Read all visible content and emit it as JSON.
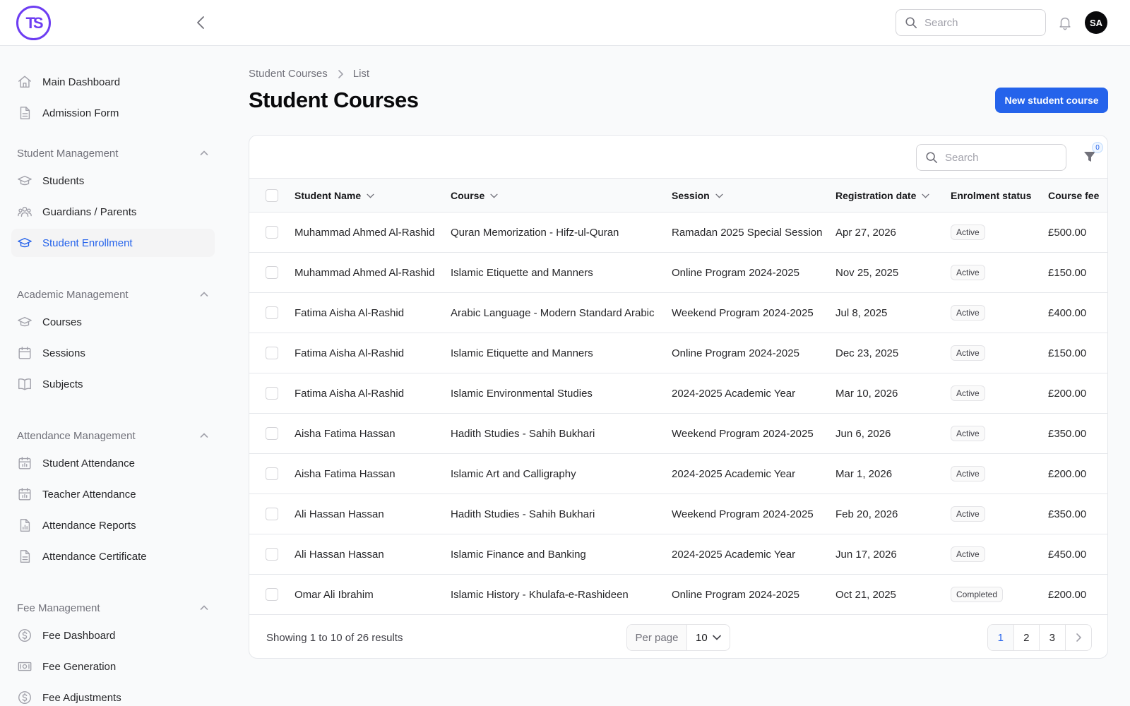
{
  "topbar": {
    "logo_text": "TS",
    "search_placeholder": "Search",
    "avatar_initials": "SA"
  },
  "sidebar": {
    "items_top": [
      {
        "label": "Main Dashboard",
        "icon": "home-icon"
      },
      {
        "label": "Admission Form",
        "icon": "document-icon"
      }
    ],
    "groups": [
      {
        "label": "Student Management",
        "items": [
          {
            "label": "Students",
            "icon": "graduation-cap-icon"
          },
          {
            "label": "Guardians / Parents",
            "icon": "users-icon"
          },
          {
            "label": "Student Enrollment",
            "icon": "graduation-cap-icon",
            "active": true
          }
        ]
      },
      {
        "label": "Academic Management",
        "items": [
          {
            "label": "Courses",
            "icon": "graduation-cap-icon"
          },
          {
            "label": "Sessions",
            "icon": "calendar-icon"
          },
          {
            "label": "Subjects",
            "icon": "book-icon"
          }
        ]
      },
      {
        "label": "Attendance Management",
        "items": [
          {
            "label": "Student Attendance",
            "icon": "calendar-chart-icon"
          },
          {
            "label": "Teacher Attendance",
            "icon": "calendar-chart-icon"
          },
          {
            "label": "Attendance Reports",
            "icon": "report-icon"
          },
          {
            "label": "Attendance Certificate",
            "icon": "document-icon"
          }
        ]
      },
      {
        "label": "Fee Management",
        "items": [
          {
            "label": "Fee Dashboard",
            "icon": "dollar-circle-icon"
          },
          {
            "label": "Fee Generation",
            "icon": "banknote-icon"
          },
          {
            "label": "Fee Adjustments",
            "icon": "dollar-circle-icon"
          }
        ]
      }
    ]
  },
  "breadcrumb": {
    "parent": "Student Courses",
    "current": "List"
  },
  "page_title": "Student Courses",
  "primary_action": "New student course",
  "table": {
    "search_placeholder": "Search",
    "filter_count": "0",
    "columns": [
      "Student Name",
      "Course",
      "Session",
      "Registration date",
      "Enrolment status",
      "Course fee"
    ],
    "rows": [
      [
        "Muhammad Ahmed Al-Rashid",
        "Quran Memorization - Hifz-ul-Quran",
        "Ramadan 2025 Special Session",
        "Apr 27, 2026",
        "Active",
        "£500.00"
      ],
      [
        "Muhammad Ahmed Al-Rashid",
        "Islamic Etiquette and Manners",
        "Online Program 2024-2025",
        "Nov 25, 2025",
        "Active",
        "£150.00"
      ],
      [
        "Fatima Aisha Al-Rashid",
        "Arabic Language - Modern Standard Arabic",
        "Weekend Program 2024-2025",
        "Jul 8, 2025",
        "Active",
        "£400.00"
      ],
      [
        "Fatima Aisha Al-Rashid",
        "Islamic Etiquette and Manners",
        "Online Program 2024-2025",
        "Dec 23, 2025",
        "Active",
        "£150.00"
      ],
      [
        "Fatima Aisha Al-Rashid",
        "Islamic Environmental Studies",
        "2024-2025 Academic Year",
        "Mar 10, 2026",
        "Active",
        "£200.00"
      ],
      [
        "Aisha Fatima Hassan",
        "Hadith Studies - Sahih Bukhari",
        "Weekend Program 2024-2025",
        "Jun 6, 2026",
        "Active",
        "£350.00"
      ],
      [
        "Aisha Fatima Hassan",
        "Islamic Art and Calligraphy",
        "2024-2025 Academic Year",
        "Mar 1, 2026",
        "Active",
        "£200.00"
      ],
      [
        "Ali Hassan Hassan",
        "Hadith Studies - Sahih Bukhari",
        "Weekend Program 2024-2025",
        "Feb 20, 2026",
        "Active",
        "£350.00"
      ],
      [
        "Ali Hassan Hassan",
        "Islamic Finance and Banking",
        "2024-2025 Academic Year",
        "Jun 17, 2026",
        "Active",
        "£450.00"
      ],
      [
        "Omar Ali Ibrahim",
        "Islamic History - Khulafa-e-Rashideen",
        "Online Program 2024-2025",
        "Oct 21, 2025",
        "Completed",
        "£200.00"
      ]
    ],
    "results_text": "Showing 1 to 10 of 26 results",
    "per_page_label": "Per page",
    "per_page_value": "10",
    "pages": [
      "1",
      "2",
      "3"
    ],
    "current_page": "1"
  }
}
